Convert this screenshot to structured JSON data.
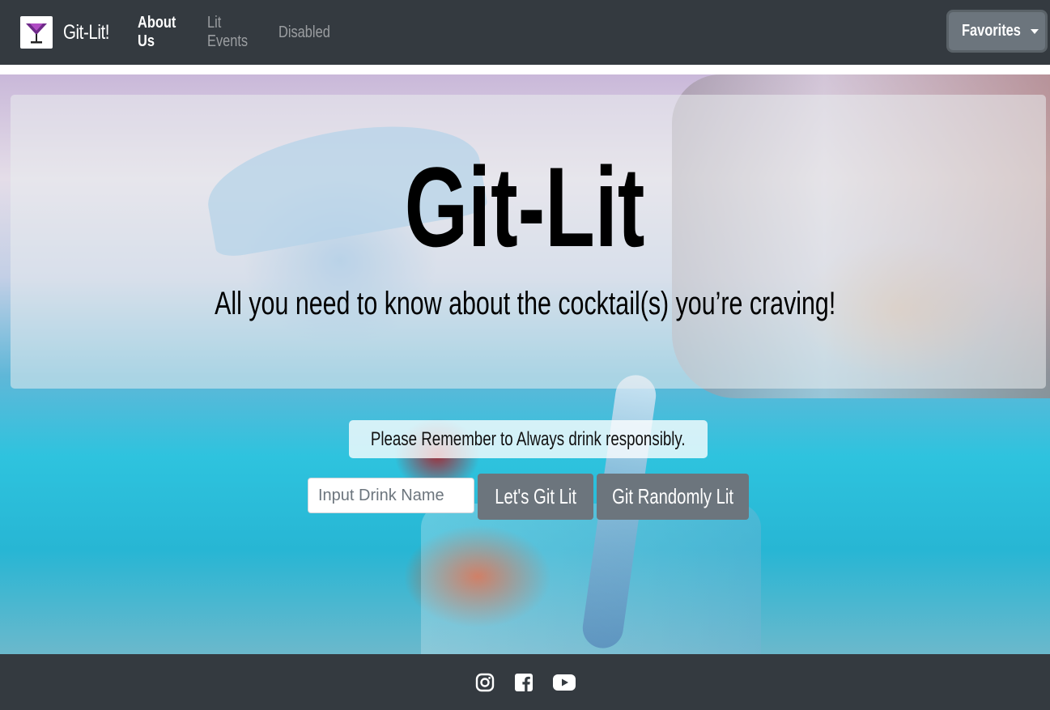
{
  "colors": {
    "navbar_bg": "#343a40",
    "button_bg": "#6c757d",
    "footer_bg": "#343a40",
    "logo_accent": "#6f2a8a"
  },
  "navbar": {
    "brand": "Git-Lit!",
    "logo_icon": "cocktail-glass-icon",
    "links": [
      {
        "label": "About Us",
        "active": true
      },
      {
        "label": "Lit Events",
        "active": false
      },
      {
        "label": "Disabled",
        "active": false
      }
    ],
    "favorites_label": "Favorites"
  },
  "jumbotron": {
    "title": "Git-Lit",
    "subtitle": "All you need to know about the cocktail(s) you’re craving!"
  },
  "notice": "Please Remember to Always drink responsibly.",
  "search": {
    "placeholder": "Input Drink Name",
    "value": "",
    "submit_label": "Let's Git Lit",
    "random_label": "Git Randomly Lit"
  },
  "footer": {
    "icons": [
      "instagram-icon",
      "facebook-icon",
      "youtube-icon"
    ]
  }
}
